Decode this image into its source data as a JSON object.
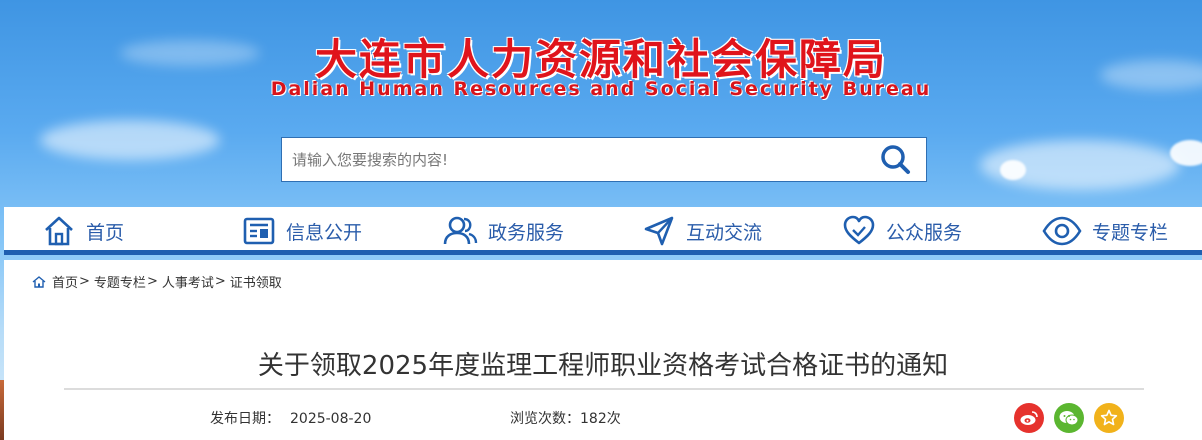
{
  "header": {
    "title": "大连市人力资源和社会保障局",
    "subtitle": "Dalian Human Resources and Social Security Bureau",
    "title_color": "#e0141b"
  },
  "search": {
    "placeholder": "请输入您要搜索的内容!",
    "value": "",
    "icon": "search-icon"
  },
  "nav": {
    "accent": "#1f5fb0",
    "items": [
      {
        "label": "首页",
        "icon": "home-icon"
      },
      {
        "label": "信息公开",
        "icon": "info-board-icon"
      },
      {
        "label": "政务服务",
        "icon": "users-icon"
      },
      {
        "label": "互动交流",
        "icon": "send-icon"
      },
      {
        "label": "公众服务",
        "icon": "heart-icon"
      },
      {
        "label": "专题专栏",
        "icon": "eye-icon"
      }
    ]
  },
  "breadcrumb": {
    "icon": "home-icon",
    "items": [
      "首页",
      "专题专栏",
      "人事考试",
      "证书领取"
    ],
    "separator": ">"
  },
  "article": {
    "title": "关于领取2025年度监理工程师职业资格考试合格证书的通知",
    "publish_label": "发布日期：",
    "publish_date": "2025-08-20",
    "views_label": "浏览次数：",
    "views": "182次"
  },
  "share": {
    "buttons": [
      {
        "icon": "weibo-icon",
        "color": "#e6322d"
      },
      {
        "icon": "wechat-icon",
        "color": "#5bb630"
      },
      {
        "icon": "star-icon",
        "color": "#f1b21b"
      }
    ]
  }
}
